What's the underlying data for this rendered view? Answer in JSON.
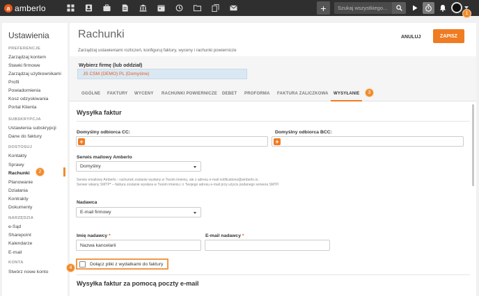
{
  "header": {
    "brand": "amberlo",
    "search_placeholder": "Szukaj wszystkiego...",
    "icons": [
      "dashboard-icon",
      "contacts-icon",
      "briefcase-icon",
      "document-icon",
      "bank-icon",
      "calendar-icon",
      "history-icon",
      "folder-icon",
      "files-icon",
      "mail-icon"
    ],
    "accent_color": "#ef7c22"
  },
  "markers": [
    "1",
    "2",
    "3",
    "4"
  ],
  "sidebar": {
    "title": "Ustawienia",
    "sections": [
      {
        "label": "PREFERENCJE",
        "items": [
          "Zarządzaj kontem",
          "Stawki firmowe",
          "Zarządzaj użytkownikami",
          "Profil",
          "Powiadomienia",
          "Kosz odzyskiwania",
          "Portal Klienta"
        ]
      },
      {
        "label": "SUBSKRYPCJA",
        "items": [
          "Ustawienia subskrypcji",
          "Dane do faktury"
        ]
      },
      {
        "label": "DOSTOSUJ",
        "items": [
          "Kontakty",
          "Sprawy",
          "Rachunki",
          "Planowanie",
          "Działania",
          "Kontrakty",
          "Dokumenty"
        ]
      },
      {
        "label": "NARZĘDZIA",
        "items": [
          "e-Sąd",
          "Sharepoint",
          "Kalendarze",
          "E-mail"
        ]
      },
      {
        "label": "KONTA",
        "items": [
          "Stwórz nowe konto"
        ]
      }
    ],
    "active_item": "Rachunki"
  },
  "page": {
    "title": "Rachunki",
    "subtitle": "Zarządzaj ustawieniami rozliczeń, konfiguruj faktury, wyceny i rachunki powiernicze",
    "cancel_label": "ANULUJ",
    "save_label": "ZAPISZ"
  },
  "company": {
    "label": "Wybierz firmę (lub oddział)",
    "value": "JS CSM (DEMO) PL (Domyślne)"
  },
  "tabs": [
    "OGÓLNE",
    "FAKTURY",
    "WYCENY",
    "RACHUNKI POWIERNICZE",
    "DEBET",
    "PROFORMA",
    "FAKTURA ZALICZKOWA",
    "WYSYŁANIE"
  ],
  "active_tab": "WYSYŁANIE",
  "form": {
    "section_title": "Wysyłka faktur",
    "cc_label": "Domyślny odbiorca CC:",
    "bcc_label": "Domyślny odbiorca BCC:",
    "add_symbol": "+",
    "mail_server_label": "Serwis mailowy Amberlo",
    "mail_server_value": "Domyślny",
    "help_line1": "Serwis emailowy Amberlo - rachunek zostanie wysłany w Twoim imieniu, ale z adresu e-mail notifications@amberlo.io.",
    "help_line2": "Serwer własny SMTP* – faktura zostanie wysłana w Twoim imieniu i z Twojego adresu e-mail przy użyciu podanego serwera SMTP.",
    "sender_label": "Nadawca",
    "sender_value": "E-mail firmowy",
    "sender_name_label": "Imię nadawcy",
    "sender_name_value": "Nazwa kancelarii",
    "sender_email_label": "E-mail nadawcy",
    "sender_email_value": "",
    "required_mark": "*",
    "attach_label": "Dołącz pliki z wydatkami do faktury",
    "attach_checked": false,
    "section2_title": "Wysyłka faktur za pomocą poczty e-mail"
  }
}
